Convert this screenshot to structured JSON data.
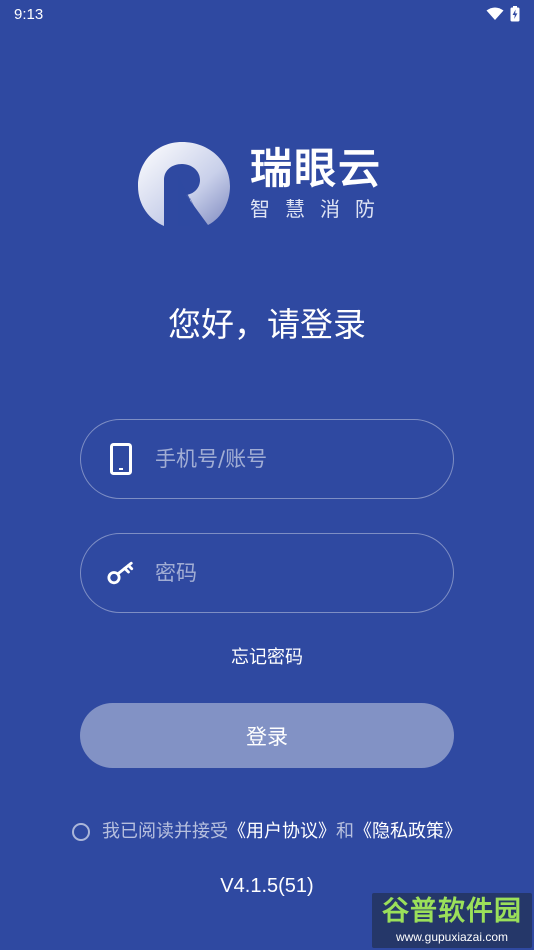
{
  "status_bar": {
    "time": "9:13",
    "icons": [
      "wifi-icon",
      "battery-charging-icon"
    ]
  },
  "brand": {
    "name": "瑞眼云",
    "subtitle": "智慧消防",
    "logo_icon": "ruiyan-logo-icon"
  },
  "greeting": "您好，请登录",
  "form": {
    "account_placeholder": "手机号/账号",
    "account_icon": "phone-icon",
    "password_placeholder": "密码",
    "password_icon": "key-icon"
  },
  "forgot_password": "忘记密码",
  "login_button": "登录",
  "agreement": {
    "prefix": "我已阅读并接受",
    "user_agreement": "《用户协议》",
    "conjunction": "和",
    "privacy_policy": "《隐私政策》"
  },
  "version": "V4.1.5(51)",
  "watermark": {
    "title": "谷普软件园",
    "url": "www.gupuxiazai.com"
  },
  "colors": {
    "background": "#2f49a1",
    "button": "#8292c5",
    "watermark_green": "#9be05a"
  }
}
